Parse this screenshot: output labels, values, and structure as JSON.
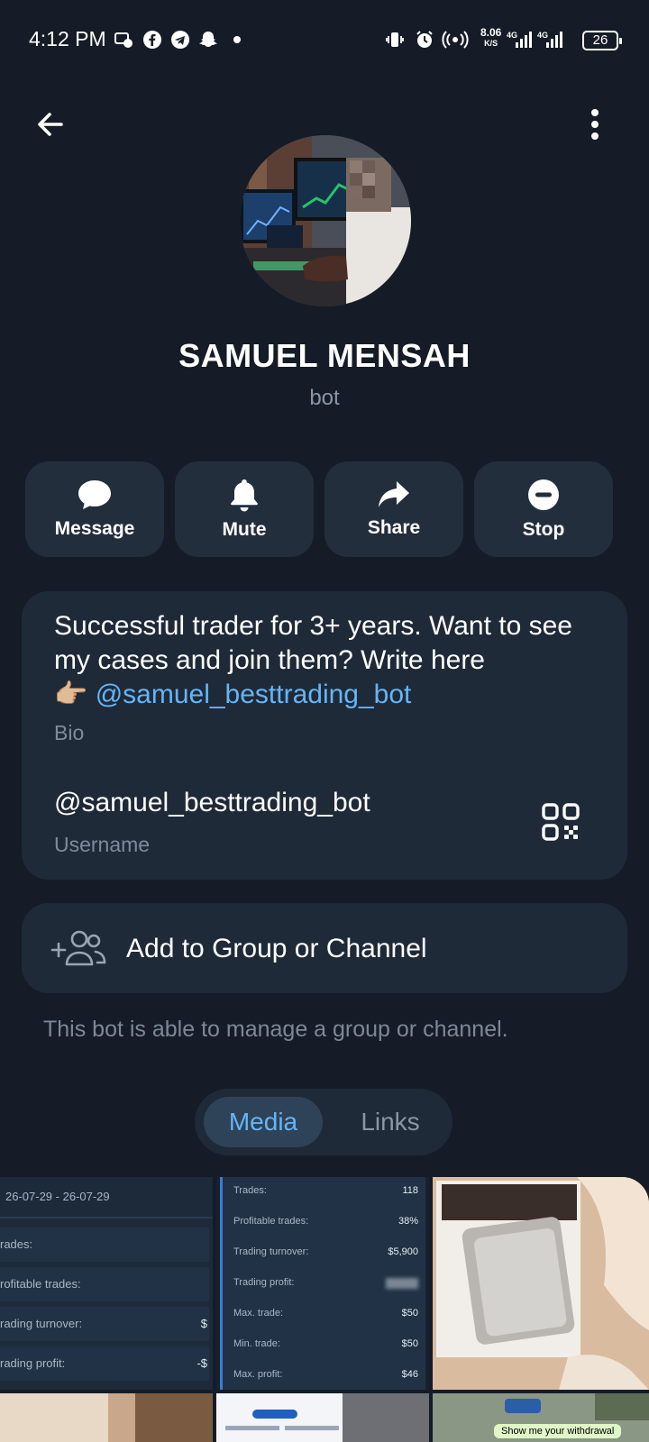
{
  "status_bar": {
    "time": "4:12 PM",
    "net_speed_value": "8.06",
    "net_speed_unit": "K/S",
    "battery": "26",
    "notification_icons": [
      "message-icon",
      "facebook-icon",
      "telegram-icon",
      "snapchat-icon",
      "dot-icon"
    ],
    "system_icons": [
      "vibrate-icon",
      "alarm-icon",
      "hotspot-icon",
      "signal-4g-icon",
      "signal-4g-icon",
      "battery-icon"
    ]
  },
  "header": {
    "back_icon": "arrow-left-icon",
    "more_icon": "more-vertical-icon"
  },
  "profile": {
    "name": "SAMUEL MENSAH",
    "status": "bot"
  },
  "actions": [
    {
      "label": "Message",
      "icon": "chat-bubble-icon"
    },
    {
      "label": "Mute",
      "icon": "bell-icon"
    },
    {
      "label": "Share",
      "icon": "share-icon"
    },
    {
      "label": "Stop",
      "icon": "stop-icon"
    }
  ],
  "info": {
    "bio_text": "Successful trader for 3+ years. Want to see my cases and join them? Write here",
    "bio_emoji": "👉🏼",
    "bio_link": "@samuel_besttrading_bot",
    "bio_label": "Bio",
    "username": "@samuel_besttrading_bot",
    "username_label": "Username"
  },
  "add_group": {
    "label": "Add to Group or Channel",
    "hint": "This bot is able to manage a group or channel."
  },
  "tabs": {
    "media": "Media",
    "links": "Links",
    "active": "Media"
  },
  "media_grid": {
    "tile1": {
      "date": "26-07-29 - 26-07-29",
      "rows": [
        {
          "label": "rades:",
          "value": ""
        },
        {
          "label": "rofitable trades:",
          "value": ""
        },
        {
          "label": "rading turnover:",
          "value": "$"
        },
        {
          "label": "rading profit:",
          "value": "-$"
        }
      ]
    },
    "tile2": {
      "rows": [
        {
          "label": "Trades:",
          "value": "118"
        },
        {
          "label": "Profitable trades:",
          "value": "38%"
        },
        {
          "label": "Trading turnover:",
          "value": "$5,900"
        },
        {
          "label": "Trading profit:",
          "value": ""
        },
        {
          "label": "Max. trade:",
          "value": "$50"
        },
        {
          "label": "Min. trade:",
          "value": "$50"
        },
        {
          "label": "Max. profit:",
          "value": "$46"
        }
      ]
    },
    "tile6_text": "Show me your withdrawal"
  },
  "colors": {
    "background": "#151c27",
    "card": "#1f2a38",
    "button": "#232e3d",
    "accent": "#64b5f6",
    "secondary_text": "#7f8b9b"
  }
}
